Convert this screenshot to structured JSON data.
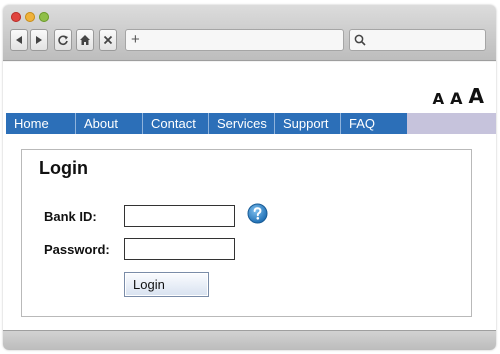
{
  "browser": {
    "new_tab_label": "+",
    "search_placeholder": ""
  },
  "font_sizer": {
    "small": "A",
    "medium": "A",
    "large": "A"
  },
  "menu": {
    "items": [
      {
        "label": "Home"
      },
      {
        "label": "About"
      },
      {
        "label": "Contact"
      },
      {
        "label": "Services"
      },
      {
        "label": "Support"
      },
      {
        "label": "FAQ"
      }
    ]
  },
  "login": {
    "title": "Login",
    "bank_id_label": "Bank ID:",
    "bank_id_value": "",
    "password_label": "Password:",
    "password_value": "",
    "submit_label": "Login"
  },
  "icons": {
    "back": "back-arrow-icon",
    "forward": "forward-arrow-icon",
    "reload": "reload-icon",
    "home": "home-icon",
    "stop": "close-icon",
    "search": "search-icon",
    "help": "help-icon"
  },
  "colors": {
    "menu_bar": "#2c6fb8",
    "menu_bar_tail": "#c6c3dc",
    "help_icon": "#2e7fc1"
  }
}
